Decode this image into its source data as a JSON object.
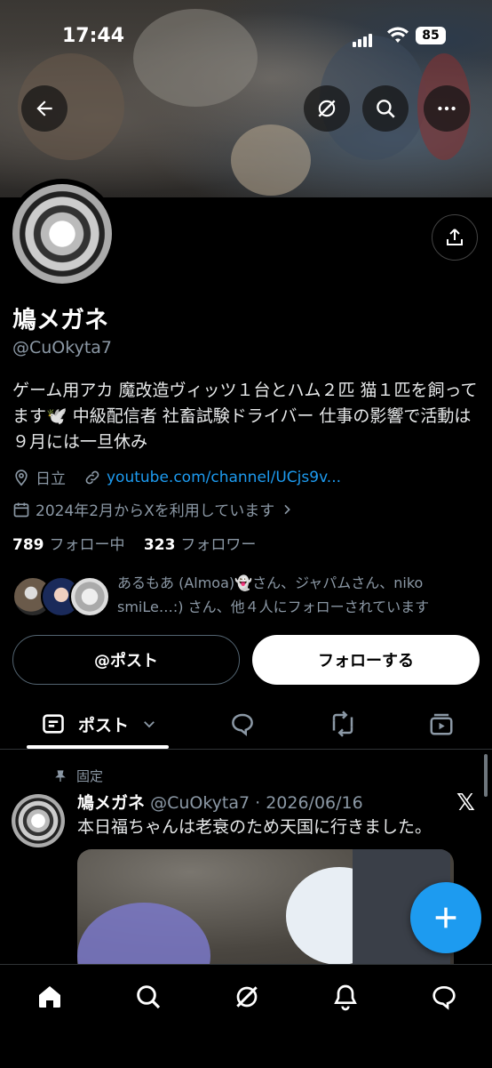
{
  "status_bar": {
    "time": "17:44",
    "battery": "85"
  },
  "profile": {
    "name": "鳩メガネ",
    "handle": "@CuOkyta7",
    "bio": "ゲーム用アカ 魔改造ヴィッツ１台とハム２匹 猫１匹を飼ってます🕊️ 中級配信者 社畜試験ドライバー 仕事の影響で活動は９月には一旦休み",
    "location": "日立",
    "link": "youtube.com/channel/UCjs9v...",
    "joined": "2024年2月からXを利用しています",
    "following_count": "789",
    "following_label": "フォロー中",
    "followers_count": "323",
    "followers_label": "フォロワー",
    "followed_by": "あるもあ (Almoa)👻さん、ジャパムさん、niko smiLe…:) さん、他４人にフォローされています"
  },
  "buttons": {
    "mention": "@ポスト",
    "follow": "フォローする"
  },
  "tabs": {
    "posts": "ポスト"
  },
  "post": {
    "pinned_label": "固定",
    "author": "鳩メガネ",
    "meta": "@CuOkyta7 · 2026/06/16",
    "text": "本日福ちゃんは老衰のため天国に行きました。",
    "source_logo": "𝕏"
  },
  "icons": [
    "back-icon",
    "grok-icon",
    "search-icon",
    "more-icon",
    "share-icon",
    "location-icon",
    "link-icon",
    "calendar-icon",
    "home-icon",
    "explore-icon",
    "notifications-icon",
    "messages-icon",
    "compose-icon"
  ],
  "colors": {
    "accent": "#1d9bf0",
    "background": "#000000",
    "muted": "#8b98a5"
  }
}
